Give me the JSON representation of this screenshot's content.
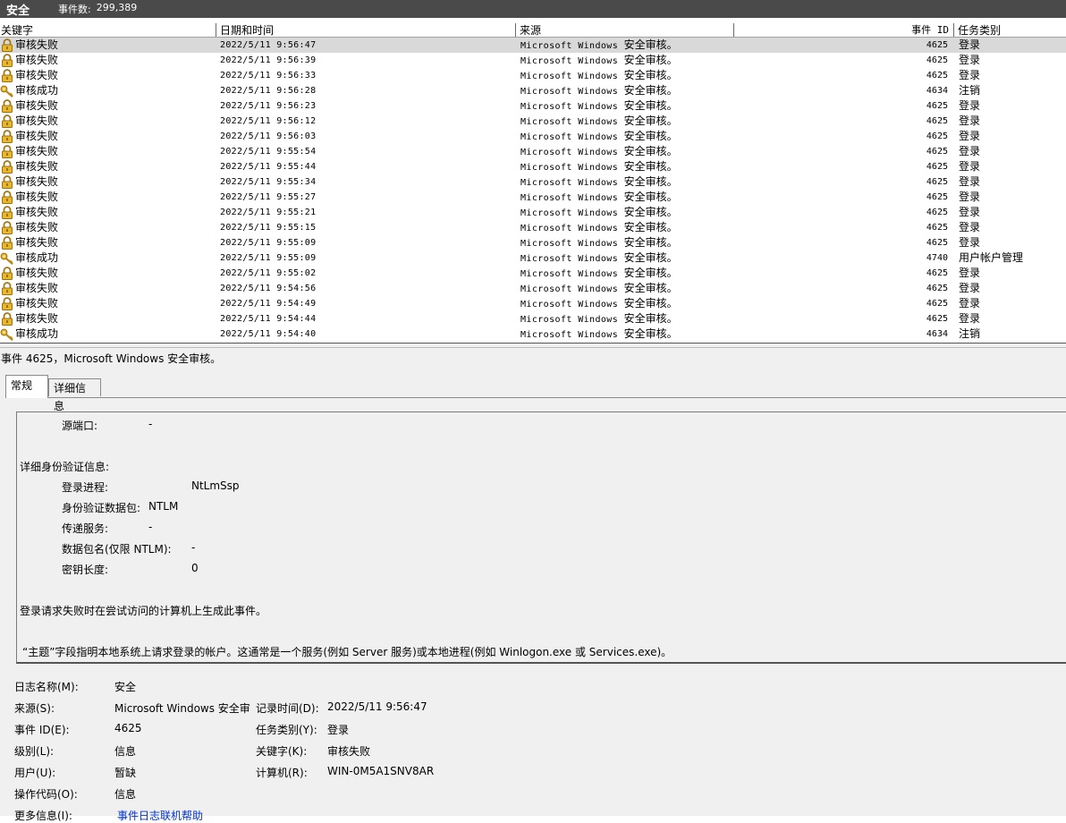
{
  "titlebar": {
    "log_name": "安全",
    "count_label": "事件数:",
    "count_value": "299,389"
  },
  "columns": {
    "keyword": "关键字",
    "datetime": "日期和时间",
    "source": "来源",
    "event_id": "事件 ID",
    "category": "任务类别"
  },
  "events": [
    {
      "icon": "lock-icon",
      "keyword": "审核失败",
      "datetime": "2022/5/11 9:56:47",
      "source_en": "Microsoft Windows",
      "source_cn": "安全审核。",
      "id": "4625",
      "category": "登录"
    },
    {
      "icon": "lock-icon",
      "keyword": "审核失败",
      "datetime": "2022/5/11 9:56:39",
      "source_en": "Microsoft Windows",
      "source_cn": "安全审核。",
      "id": "4625",
      "category": "登录"
    },
    {
      "icon": "lock-icon",
      "keyword": "审核失败",
      "datetime": "2022/5/11 9:56:33",
      "source_en": "Microsoft Windows",
      "source_cn": "安全审核。",
      "id": "4625",
      "category": "登录"
    },
    {
      "icon": "key-icon",
      "keyword": "审核成功",
      "datetime": "2022/5/11 9:56:28",
      "source_en": "Microsoft Windows",
      "source_cn": "安全审核。",
      "id": "4634",
      "category": "注销"
    },
    {
      "icon": "lock-icon",
      "keyword": "审核失败",
      "datetime": "2022/5/11 9:56:23",
      "source_en": "Microsoft Windows",
      "source_cn": "安全审核。",
      "id": "4625",
      "category": "登录"
    },
    {
      "icon": "lock-icon",
      "keyword": "审核失败",
      "datetime": "2022/5/11 9:56:12",
      "source_en": "Microsoft Windows",
      "source_cn": "安全审核。",
      "id": "4625",
      "category": "登录"
    },
    {
      "icon": "lock-icon",
      "keyword": "审核失败",
      "datetime": "2022/5/11 9:56:03",
      "source_en": "Microsoft Windows",
      "source_cn": "安全审核。",
      "id": "4625",
      "category": "登录"
    },
    {
      "icon": "lock-icon",
      "keyword": "审核失败",
      "datetime": "2022/5/11 9:55:54",
      "source_en": "Microsoft Windows",
      "source_cn": "安全审核。",
      "id": "4625",
      "category": "登录"
    },
    {
      "icon": "lock-icon",
      "keyword": "审核失败",
      "datetime": "2022/5/11 9:55:44",
      "source_en": "Microsoft Windows",
      "source_cn": "安全审核。",
      "id": "4625",
      "category": "登录"
    },
    {
      "icon": "lock-icon",
      "keyword": "审核失败",
      "datetime": "2022/5/11 9:55:34",
      "source_en": "Microsoft Windows",
      "source_cn": "安全审核。",
      "id": "4625",
      "category": "登录"
    },
    {
      "icon": "lock-icon",
      "keyword": "审核失败",
      "datetime": "2022/5/11 9:55:27",
      "source_en": "Microsoft Windows",
      "source_cn": "安全审核。",
      "id": "4625",
      "category": "登录"
    },
    {
      "icon": "lock-icon",
      "keyword": "审核失败",
      "datetime": "2022/5/11 9:55:21",
      "source_en": "Microsoft Windows",
      "source_cn": "安全审核。",
      "id": "4625",
      "category": "登录"
    },
    {
      "icon": "lock-icon",
      "keyword": "审核失败",
      "datetime": "2022/5/11 9:55:15",
      "source_en": "Microsoft Windows",
      "source_cn": "安全审核。",
      "id": "4625",
      "category": "登录"
    },
    {
      "icon": "lock-icon",
      "keyword": "审核失败",
      "datetime": "2022/5/11 9:55:09",
      "source_en": "Microsoft Windows",
      "source_cn": "安全审核。",
      "id": "4625",
      "category": "登录"
    },
    {
      "icon": "key-icon",
      "keyword": "审核成功",
      "datetime": "2022/5/11 9:55:09",
      "source_en": "Microsoft Windows",
      "source_cn": "安全审核。",
      "id": "4740",
      "category": "用户帐户管理"
    },
    {
      "icon": "lock-icon",
      "keyword": "审核失败",
      "datetime": "2022/5/11 9:55:02",
      "source_en": "Microsoft Windows",
      "source_cn": "安全审核。",
      "id": "4625",
      "category": "登录"
    },
    {
      "icon": "lock-icon",
      "keyword": "审核失败",
      "datetime": "2022/5/11 9:54:56",
      "source_en": "Microsoft Windows",
      "source_cn": "安全审核。",
      "id": "4625",
      "category": "登录"
    },
    {
      "icon": "lock-icon",
      "keyword": "审核失败",
      "datetime": "2022/5/11 9:54:49",
      "source_en": "Microsoft Windows",
      "source_cn": "安全审核。",
      "id": "4625",
      "category": "登录"
    },
    {
      "icon": "lock-icon",
      "keyword": "审核失败",
      "datetime": "2022/5/11 9:54:44",
      "source_en": "Microsoft Windows",
      "source_cn": "安全审核。",
      "id": "4625",
      "category": "登录"
    },
    {
      "icon": "key-icon",
      "keyword": "审核成功",
      "datetime": "2022/5/11 9:54:40",
      "source_en": "Microsoft Windows",
      "source_cn": "安全审核。",
      "id": "4634",
      "category": "注销"
    }
  ],
  "detail": {
    "title": "事件 4625，Microsoft Windows 安全审核。",
    "tabs": {
      "general": "常规",
      "details": "详细信息"
    },
    "description": {
      "source_port_label": "源端口:",
      "source_port_value": "-",
      "auth_section": "详细身份验证信息:",
      "logon_process_label": "登录进程:",
      "logon_process_value": "NtLmSsp",
      "auth_package_label": "身份验证数据包:",
      "auth_package_value": "NTLM",
      "transited_label": "传递服务:",
      "transited_value": "-",
      "package_name_label": "数据包名(仅限 NTLM):",
      "package_name_value": "-",
      "key_length_label": "密钥长度:",
      "key_length_value": "0",
      "para1": "登录请求失败时在尝试访问的计算机上生成此事件。",
      "para2": "“主题”字段指明本地系统上请求登录的帐户。这通常是一个服务(例如 Server 服务)或本地进程(例如 Winlogon.exe 或 Services.exe)。"
    },
    "props": {
      "log_name_label": "日志名称(M):",
      "log_name_value": "安全",
      "source_label": "来源(S):",
      "source_value": "Microsoft Windows 安全审",
      "logged_label": "记录时间(D):",
      "logged_value": "2022/5/11 9:56:47",
      "event_id_label": "事件 ID(E):",
      "event_id_value": "4625",
      "category_label": "任务类别(Y):",
      "category_value": "登录",
      "level_label": "级别(L):",
      "level_value": "信息",
      "keywords_label": "关键字(K):",
      "keywords_value": "审核失败",
      "user_label": "用户(U):",
      "user_value": "暂缺",
      "computer_label": "计算机(R):",
      "computer_value": "WIN-0M5A1SNV8AR",
      "opcode_label": "操作代码(O):",
      "opcode_value": "信息",
      "more_info_label": "更多信息(I):",
      "more_info_link": "事件日志联机帮助"
    }
  }
}
